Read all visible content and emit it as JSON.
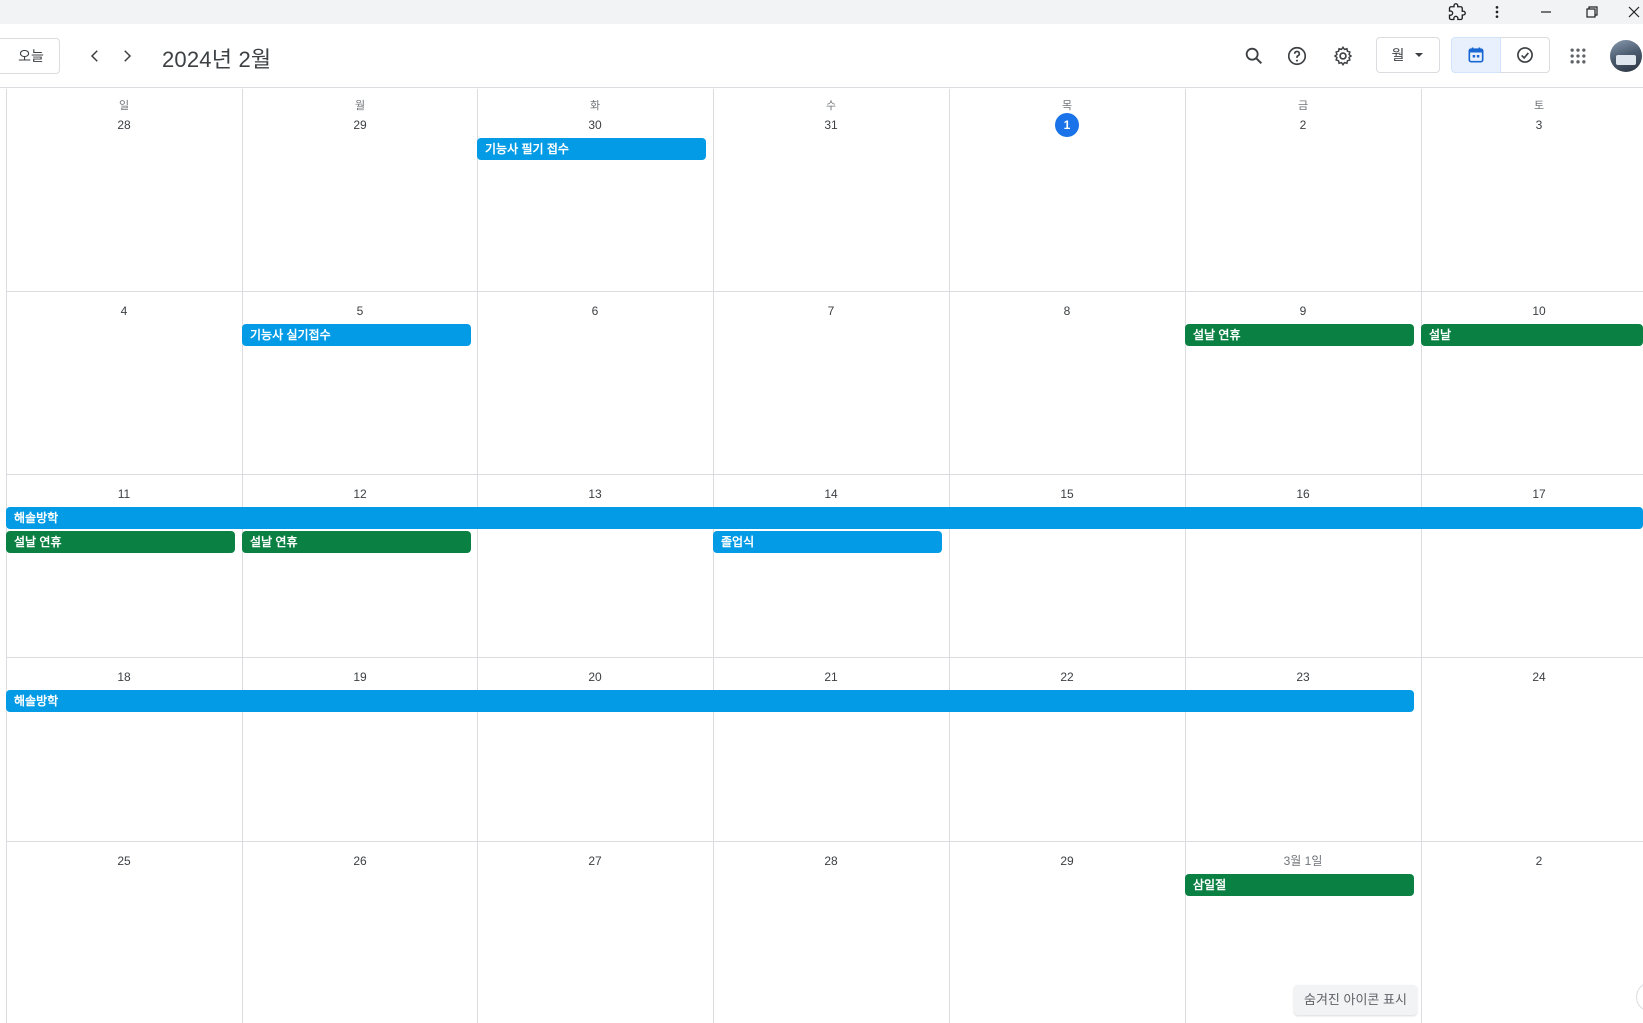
{
  "window": {
    "controls": [
      "extensions-icon",
      "more-vert-icon",
      "minimize-icon",
      "restore-icon",
      "close-icon"
    ]
  },
  "header": {
    "today_label": "오늘",
    "title": "2024년 2월",
    "view_label": "월",
    "icons": [
      "search-icon",
      "help-icon",
      "settings-icon",
      "calendar-icon",
      "task-check-icon",
      "apps-grid-icon",
      "avatar"
    ]
  },
  "weekdays": [
    "일",
    "월",
    "화",
    "수",
    "목",
    "금",
    "토"
  ],
  "weeks": [
    [
      "28",
      "29",
      "30",
      "31",
      "1",
      "2",
      "3"
    ],
    [
      "4",
      "5",
      "6",
      "7",
      "8",
      "9",
      "10"
    ],
    [
      "11",
      "12",
      "13",
      "14",
      "15",
      "16",
      "17"
    ],
    [
      "18",
      "19",
      "20",
      "21",
      "22",
      "23",
      "24"
    ],
    [
      "25",
      "26",
      "27",
      "28",
      "29",
      "3월 1일",
      "2"
    ]
  ],
  "today": {
    "week": 0,
    "day": 4
  },
  "events": [
    {
      "week": 0,
      "start": 2,
      "span": 1,
      "row": 0,
      "title": "기능사 필기 접수",
      "color": "#039be5"
    },
    {
      "week": 1,
      "start": 1,
      "span": 1,
      "row": 0,
      "title": "기능사 실기접수",
      "color": "#039be5"
    },
    {
      "week": 1,
      "start": 5,
      "span": 1,
      "row": 0,
      "title": "설날 연휴",
      "color": "#0b8043"
    },
    {
      "week": 1,
      "start": 6,
      "span": 1,
      "row": 0,
      "title": "설날",
      "color": "#0b8043"
    },
    {
      "week": 2,
      "start": 0,
      "span": 7,
      "row": 0,
      "title": "해솔방학",
      "color": "#039be5"
    },
    {
      "week": 2,
      "start": 0,
      "span": 1,
      "row": 1,
      "title": "설날 연휴",
      "color": "#0b8043"
    },
    {
      "week": 2,
      "start": 1,
      "span": 1,
      "row": 1,
      "title": "설날 연휴",
      "color": "#0b8043"
    },
    {
      "week": 2,
      "start": 3,
      "span": 1,
      "row": 1,
      "title": "졸업식",
      "color": "#039be5"
    },
    {
      "week": 3,
      "start": 0,
      "span": 6,
      "row": 0,
      "title": "해솔방학",
      "color": "#039be5"
    },
    {
      "week": 4,
      "start": 5,
      "span": 1,
      "row": 0,
      "title": "삼일절",
      "color": "#0b8043"
    }
  ],
  "tooltip": "숨겨진 아이콘 표시"
}
